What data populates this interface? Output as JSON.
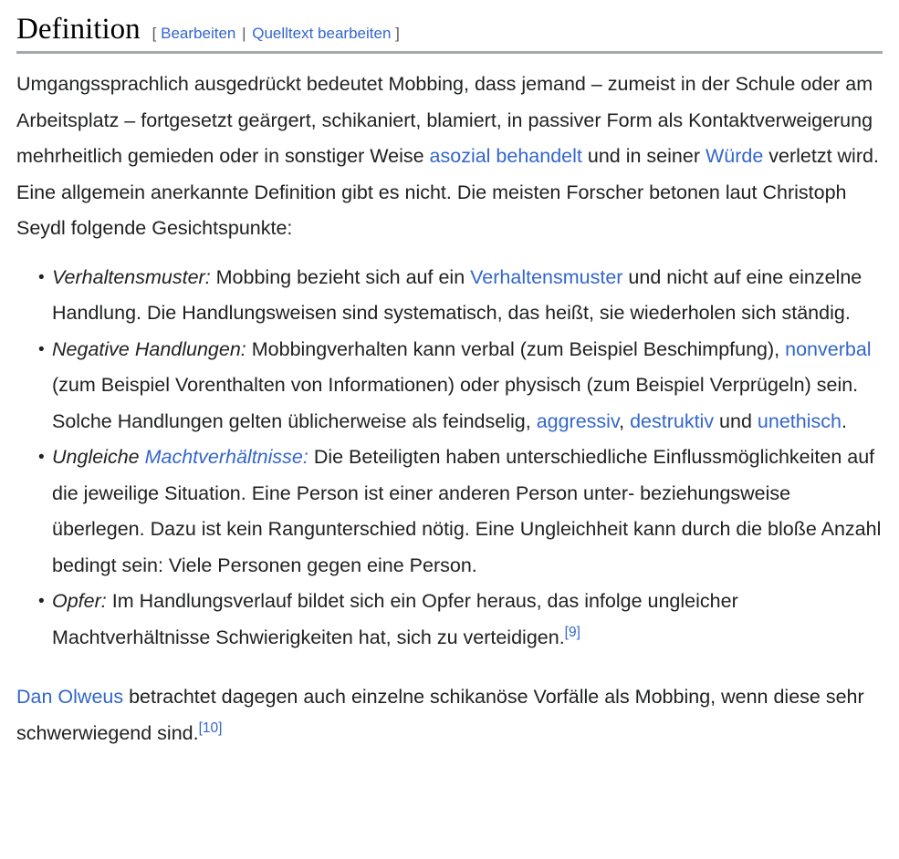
{
  "section": {
    "title": "Definition",
    "edit": {
      "open_bracket": "[",
      "edit_label": "Bearbeiten",
      "separator": "|",
      "source_edit_label": "Quelltext bearbeiten",
      "close_bracket": "]"
    }
  },
  "colors": {
    "link": "#3366cc",
    "text": "#202122",
    "rule": "#a2a9b1",
    "bracket": "#54595d"
  },
  "intro_paragraph": {
    "part1": "Umgangssprachlich ausgedrückt bedeutet Mobbing, dass jemand – zumeist in der Schule oder am Arbeitsplatz – fortgesetzt geärgert, schikaniert, blamiert, in passiver Form als Kontaktverweigerung mehrheitlich gemieden oder in sonstiger Weise ",
    "link1": "asozial behandelt",
    "part2": " und in seiner ",
    "link2": "Würde",
    "part3": " verletzt wird. Eine allgemein anerkannte Definition gibt es nicht. Die meisten Forscher betonen laut Christoph Seydl folgende Gesichtspunkte:"
  },
  "bullets": [
    {
      "lead": "Verhaltensmuster:",
      "part1": " Mobbing bezieht sich auf ein ",
      "link1": "Verhaltensmuster",
      "part2": " und nicht auf eine einzelne Handlung. Die Handlungsweisen sind systematisch, das heißt, sie wiederholen sich ständig."
    },
    {
      "lead": "Negative Handlungen:",
      "part1": " Mobbingverhalten kann verbal (zum Beispiel Beschimpfung), ",
      "link1": "nonverbal",
      "part2": " (zum Beispiel Vorenthalten von Informationen) oder physisch (zum Beispiel Verprügeln) sein. Solche Handlungen gelten üblicherweise als feindselig, ",
      "link2": "aggressiv",
      "part3": ", ",
      "link3": "destruktiv",
      "part4": " und ",
      "link4": "unethisch",
      "part5": "."
    },
    {
      "lead_plain": "Ungleiche ",
      "lead_link": "Machtverhältnisse:",
      "part1": " Die Beteiligten haben unterschiedliche Einflussmöglichkeiten auf die jeweilige Situation. Eine Person ist einer anderen Person unter- beziehungsweise überlegen. Dazu ist kein Rangunterschied nötig. Eine Ungleichheit kann durch die bloße Anzahl bedingt sein: Viele Personen gegen eine Person."
    },
    {
      "lead": "Opfer:",
      "part1": " Im Handlungsverlauf bildet sich ein Opfer heraus, das infolge ungleicher Machtverhältnisse Schwierigkeiten hat, sich zu verteidigen.",
      "ref": "[9]"
    }
  ],
  "closing_paragraph": {
    "link1": "Dan Olweus",
    "part1": " betrachtet dagegen auch einzelne schikanöse Vorfälle als Mobbing, wenn diese sehr schwerwiegend sind.",
    "ref": "[10]"
  }
}
